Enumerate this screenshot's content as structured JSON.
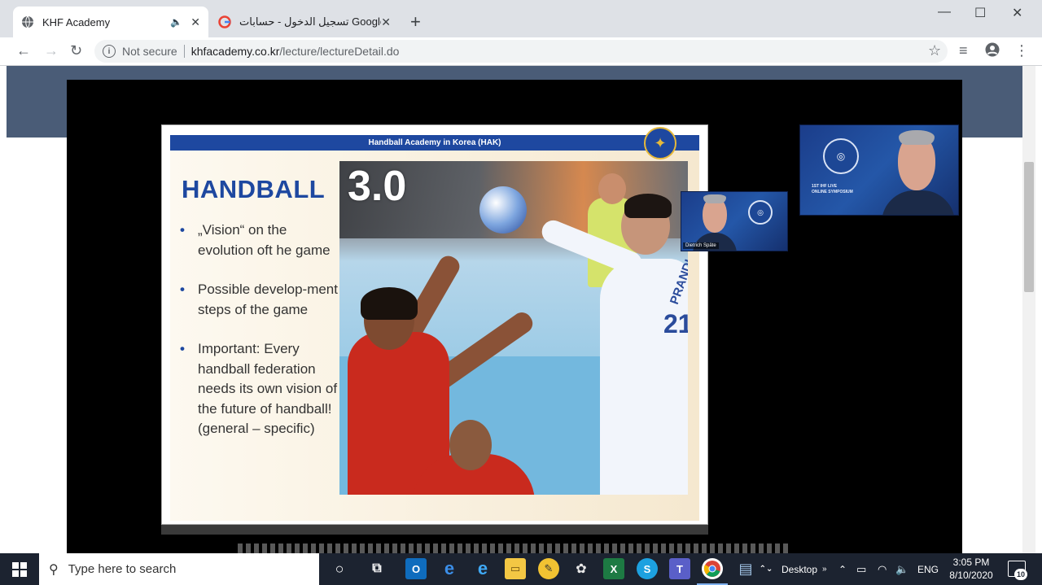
{
  "browser": {
    "tabs": [
      {
        "title": "KHF Academy",
        "active": true
      },
      {
        "title": "تسجيل الدخول - حسابات Google",
        "active": false
      }
    ],
    "new_tab": "+",
    "window_controls": {
      "minimize": "—",
      "maximize": "☐",
      "close": "✕"
    },
    "nav": {
      "back": "←",
      "forward": "→",
      "reload": "↻"
    },
    "address": {
      "security_label": "Not secure",
      "domain": "khfacademy.co.kr",
      "path": "/lecture/lectureDetail.do"
    }
  },
  "slide": {
    "header": "Handball Academy in Korea (HAK)",
    "title": "HANDBALL",
    "title_number": "3.0",
    "bullets": [
      "„Vision“ on the evolution oft he game",
      "Possible develop-ment steps of the game",
      "Important: Every handball federation needs its own vision of the future of handball! (general – specific)"
    ],
    "jersey_name": "PRANDI",
    "jersey_number": "21"
  },
  "webcams": {
    "big_text_line1": "1ST IHF LIVE",
    "big_text_line2": "ONLINE SYMPOSIUM",
    "small_name": "Dietrich Späte"
  },
  "taskbar": {
    "search_placeholder": "Type here to search",
    "desktop_label": "Desktop",
    "language": "ENG",
    "time": "3:05 PM",
    "date": "8/10/2020",
    "notifications": "10"
  },
  "colors": {
    "slide_blue": "#1e48a0",
    "page_header": "#4a5c77",
    "taskbar": "#1c2330"
  }
}
